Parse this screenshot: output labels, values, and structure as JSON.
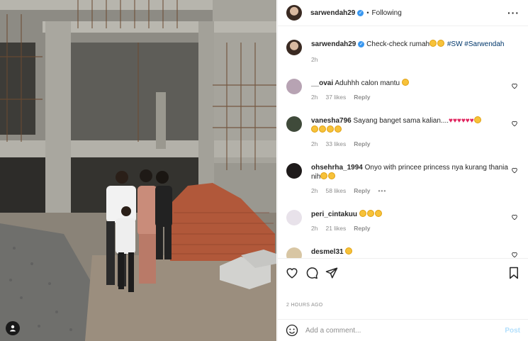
{
  "post": {
    "username": "sarwendah29",
    "follow_state": "Following",
    "more_icon": "more-options-icon"
  },
  "caption": {
    "username": "sarwendah29",
    "text": "Check-check rumah",
    "hashtags": "#SW #Sarwendah",
    "age": "2h"
  },
  "comments": [
    {
      "username": "__ovai",
      "text": "Aduhhh calon mantu",
      "age": "2h",
      "likes": "37 likes",
      "reply": "Reply"
    },
    {
      "username": "vanesha796",
      "text": "Sayang banget sama kalian....",
      "age": "2h",
      "likes": "33 likes",
      "reply": "Reply"
    },
    {
      "username": "ohsehrha_1994",
      "text": "Onyo with princee princess nya kurang thania nih",
      "age": "2h",
      "likes": "58 likes",
      "reply": "Reply",
      "more": "•••"
    },
    {
      "username": "peri_cintakuu",
      "text": "",
      "age": "2h",
      "likes": "21 likes",
      "reply": "Reply"
    },
    {
      "username": "desmel31",
      "text": ""
    }
  ],
  "timestamp": "2 HOURS AGO",
  "add_comment": {
    "placeholder": "Add a comment...",
    "post_label": "Post"
  },
  "colors": {
    "link": "#00376b",
    "verified": "#3897f0",
    "muted": "#8e8e8e",
    "post_disabled": "#b2dffc"
  }
}
